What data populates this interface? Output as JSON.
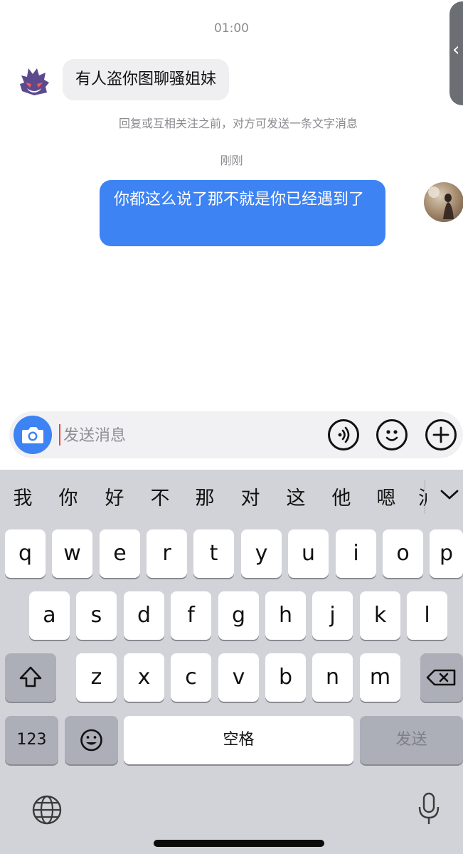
{
  "chat": {
    "top_time": "01:00",
    "incoming_message": "有人盗你图聊骚姐妹",
    "notice": "回复或互相关注之前，对方可发送一条文字消息",
    "second_time": "刚刚",
    "outgoing_message": "你都这么说了那不就是你已经遇到了"
  },
  "input": {
    "placeholder": "发送消息"
  },
  "keyboard": {
    "candidates": [
      "我",
      "你",
      "好",
      "不",
      "那",
      "对",
      "这",
      "他",
      "嗯"
    ],
    "candidate_partial": "泸",
    "row1": [
      "q",
      "w",
      "e",
      "r",
      "t",
      "y",
      "u",
      "i",
      "o",
      "p"
    ],
    "row2": [
      "a",
      "s",
      "d",
      "f",
      "g",
      "h",
      "j",
      "k",
      "l"
    ],
    "row3": [
      "z",
      "x",
      "c",
      "v",
      "b",
      "n",
      "m"
    ],
    "numbers_key": "123",
    "space_key": "空格",
    "send_key": "发送"
  },
  "icons": {
    "camera": "camera-icon",
    "voice": "voice-icon",
    "emoji": "emoji-icon",
    "add": "plus-icon",
    "shift": "shift-icon",
    "delete": "delete-icon",
    "globe": "globe-icon",
    "mic": "microphone-icon",
    "collapse": "chevron-down-icon"
  },
  "colors": {
    "accent": "#3d83f3",
    "keyboard_bg": "#d2d3d8"
  }
}
